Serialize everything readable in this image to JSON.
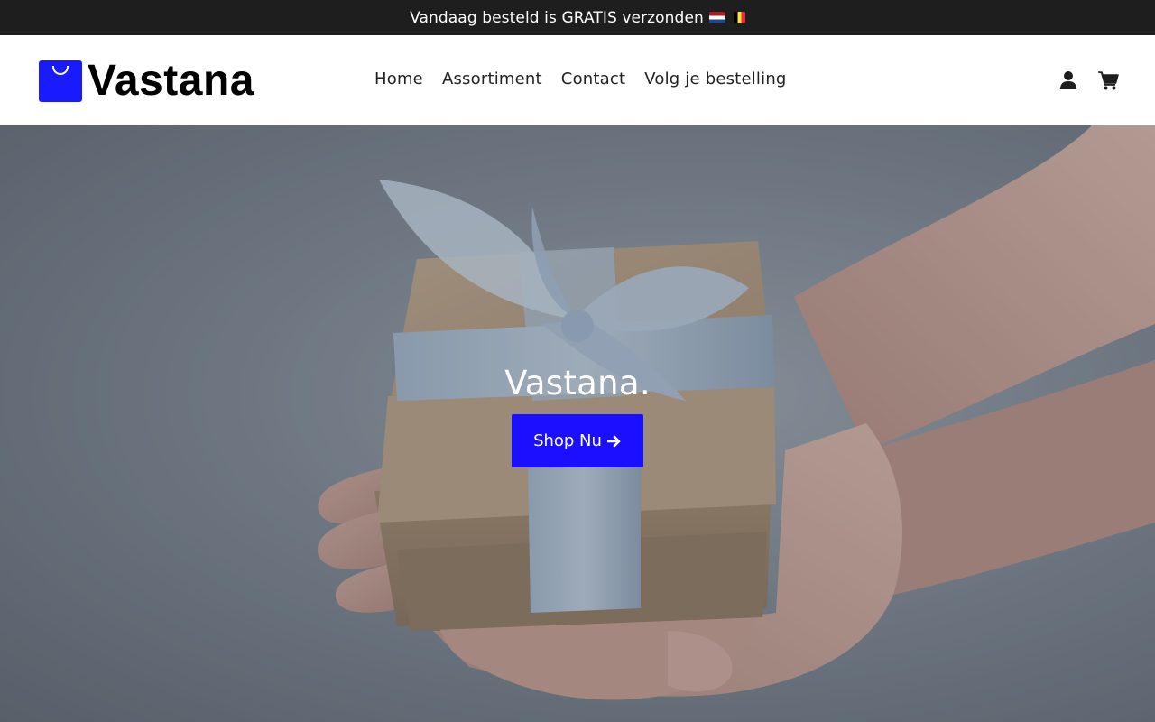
{
  "announcement": {
    "text": "Vandaag besteld is GRATIS verzonden",
    "flags": [
      "netherlands-flag",
      "belgium-flag"
    ]
  },
  "brand": {
    "name": "Vastana",
    "logo_icon": "shopping-bag-icon",
    "color": "#1a1aff"
  },
  "nav": {
    "items": [
      {
        "label": "Home"
      },
      {
        "label": "Assortiment"
      },
      {
        "label": "Contact"
      },
      {
        "label": "Volg je bestelling"
      }
    ]
  },
  "header_icons": [
    "user-icon",
    "cart-icon"
  ],
  "hero": {
    "title": "Vastana.",
    "button_label": "Shop Nu",
    "button_icon": "arrow-right-icon",
    "button_color": "#1a10ff",
    "image": "hands-holding-gift-box"
  },
  "colors": {
    "topbar_bg": "#1e1e1e"
  }
}
